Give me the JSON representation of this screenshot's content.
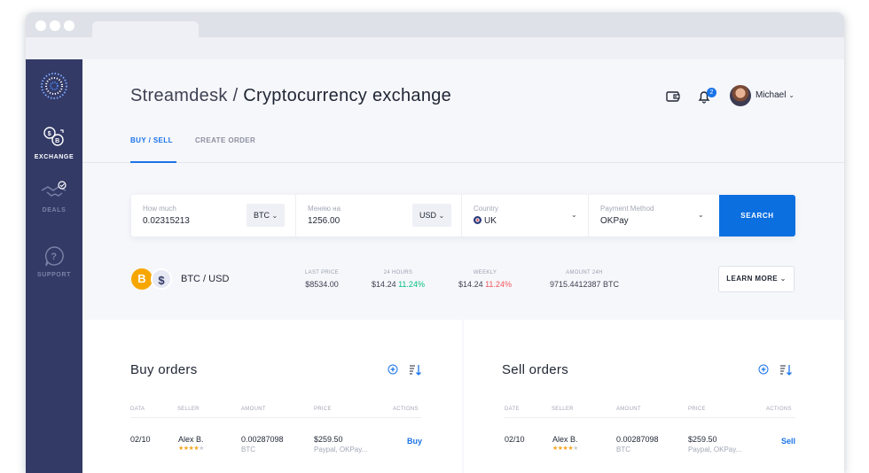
{
  "brand": {
    "app": "Streamdesk",
    "separator": " / ",
    "page": "Cryptocurrency exchange"
  },
  "sidebar": {
    "items": [
      {
        "label": "EXCHANGE",
        "active": true
      },
      {
        "label": "DEALS",
        "active": false
      },
      {
        "label": "SUPPORT",
        "active": false
      }
    ]
  },
  "header": {
    "notifications": "2",
    "user": "Michael",
    "user_chevron": "⌄"
  },
  "tabs": [
    {
      "label": "BUY / SELL",
      "active": true
    },
    {
      "label": "CREATE ORDER",
      "active": false
    }
  ],
  "search": {
    "how_much": {
      "label": "How much",
      "value": "0.02315213",
      "currency": "BTC"
    },
    "change": {
      "label": "Меняю на",
      "value": "1256.00",
      "currency": "USD"
    },
    "country": {
      "label": "Country",
      "value": "UK"
    },
    "payment": {
      "label": "Payment Method",
      "value": "OKPay"
    },
    "button": "SEARCH"
  },
  "ticker": {
    "coin1": "B",
    "coin2": "$",
    "pair": "BTC / USD",
    "last_price": {
      "label": "LAST PRICE",
      "value": "$8534.00"
    },
    "h24": {
      "label": "24 HOURS",
      "value": "$14.24",
      "change": "11.24%"
    },
    "weekly": {
      "label": "WEEKLY",
      "value": "$14.24",
      "change": "11.24%"
    },
    "amount": {
      "label": "AMOUNT 24H",
      "value": "9715.4412387 BTC"
    },
    "learn_more": "LEARN MORE"
  },
  "buy": {
    "title": "Buy orders",
    "headers": [
      "DATA",
      "SELLER",
      "AMOUNT",
      "PRICE",
      "ACTIONS"
    ],
    "row": {
      "date": "02/10",
      "seller": "Alex B.",
      "rating": 4,
      "amount": "0.00287098",
      "unit": "BTC",
      "price": "$259.50",
      "methods": "Paypal, OKPay...",
      "action": "Buy"
    }
  },
  "sell": {
    "title": "Sell orders",
    "headers": [
      "DATE",
      "SELLER",
      "AMOUNT",
      "PRICE",
      "ACTIONS"
    ],
    "row": {
      "date": "02/10",
      "seller": "Alex B.",
      "rating": 4,
      "amount": "0.00287098",
      "unit": "BTC",
      "price": "$259.50",
      "methods": "Paypal, OKPay...",
      "action": "Sell"
    }
  },
  "colors": {
    "accent": "#1a73e8",
    "sidebar": "#333a66",
    "positive": "#00c17c",
    "negative": "#f2545b",
    "star": "#f5a623"
  }
}
